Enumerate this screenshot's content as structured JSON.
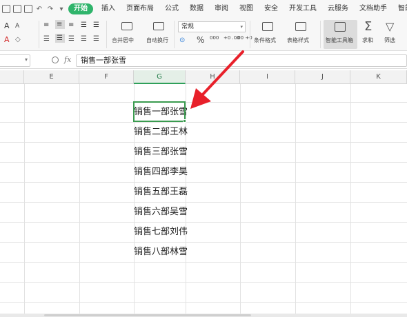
{
  "quick_access": {
    "icons": [
      "save-icon",
      "print-icon",
      "print-preview-icon",
      "undo-icon",
      "redo-icon",
      "customize-icon"
    ]
  },
  "menu": {
    "tabs": [
      {
        "name": "tab-home",
        "label": "开始",
        "active": true
      },
      {
        "name": "tab-insert",
        "label": "插入"
      },
      {
        "name": "tab-page-layout",
        "label": "页面布局"
      },
      {
        "name": "tab-formulas",
        "label": "公式"
      },
      {
        "name": "tab-data",
        "label": "数据"
      },
      {
        "name": "tab-review",
        "label": "审阅"
      },
      {
        "name": "tab-view",
        "label": "视图"
      },
      {
        "name": "tab-security",
        "label": "安全"
      },
      {
        "name": "tab-developer",
        "label": "开发工具"
      },
      {
        "name": "tab-cloud",
        "label": "云服务"
      },
      {
        "name": "tab-doc-helper",
        "label": "文档助手"
      },
      {
        "name": "tab-smart",
        "label": "智能工"
      }
    ]
  },
  "ribbon": {
    "number_format": "常规",
    "merge_center": "合并居中",
    "wrap_text": "自动换行",
    "conditional_format": "条件格式",
    "table_style": "表格样式",
    "smart_toolbox": "智能工具箱",
    "sum": "求和",
    "filter": "筛选",
    "percent": "%",
    "thousands": "000",
    "increase_decimal": "+0 .00",
    "decrease_decimal": ".00 +0",
    "font_grow": "A",
    "font_shrink": "A"
  },
  "formula_bar": {
    "fx_label": "fx",
    "content": "销售一部张雪"
  },
  "columns": [
    "E",
    "F",
    "G",
    "H",
    "I",
    "J",
    "K"
  ],
  "selected_column": "G",
  "cells": [
    "销售一部张雪",
    "销售二部王林",
    "销售三部张雪",
    "销售四部李昊",
    "销售五部王磊",
    "销售六部吴雪",
    "销售七部刘伟",
    "销售八部林雪"
  ],
  "colors": {
    "accent": "#2fb46b",
    "selection": "#3a9b4f",
    "arrow": "#e8202a"
  }
}
